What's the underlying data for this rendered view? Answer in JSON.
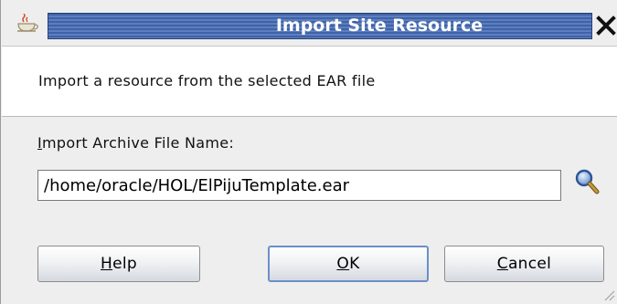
{
  "window": {
    "title": "Import Site Resource",
    "icon": "java-coffee-cup-icon",
    "close_icon": "close-icon"
  },
  "header": {
    "description": "Import a resource from the selected EAR file"
  },
  "form": {
    "label": "Import Archive File Name:",
    "file_path": "/home/oracle/HOL/ElPijuTemplate.ear",
    "browse_icon": "magnifier-icon"
  },
  "buttons": {
    "help": "Help",
    "ok": "OK",
    "cancel": "Cancel"
  },
  "colors": {
    "title_band": "#4a6cb0",
    "dialog_bg": "#eeeeee",
    "header_bg": "#ffffff",
    "ok_focus_border": "#6b8fc9"
  }
}
